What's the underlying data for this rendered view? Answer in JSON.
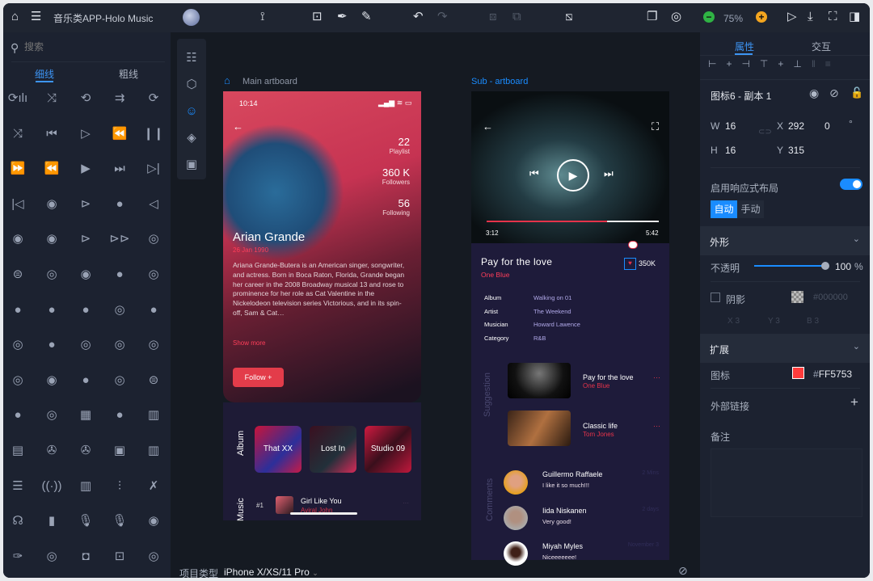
{
  "app": {
    "title": "音乐类APP-Holo Music",
    "zoom": "75%"
  },
  "toolbar": {
    "icons": [
      "home-icon",
      "menu-icon",
      "avatar",
      "path-icon",
      "add-frame-icon",
      "pen-icon",
      "pencil-icon",
      "undo-icon",
      "redo-icon",
      "group-icon",
      "ungroup-icon",
      "resize-icon",
      "preview-frame-icon",
      "settings-icon",
      "zoom-out-icon",
      "zoom-in-icon",
      "play-icon",
      "download-icon",
      "fullscreen-icon",
      "panel-toggle-icon"
    ]
  },
  "left": {
    "search_placeholder": "搜索",
    "tabs": [
      "细线",
      "粗线"
    ],
    "active_tab": 0,
    "icons": [
      "repeat-one",
      "equalizer",
      "shuffle",
      "repeat",
      "list-arrows",
      "repeat-list",
      "shuffle-2",
      "skip-back-filled",
      "play-outline",
      "rewind-outline",
      "pause",
      "fast-forward-filled",
      "rewind-filled",
      "play-filled",
      "skip-next-filled",
      "skip-next-outline",
      "skip-back-outline",
      "prev-circle-filled",
      "next-circle-outline",
      "play-circle-filled",
      "rewind-circle",
      "next-circle-filled",
      "prev-circle-2",
      "play-circle-outline",
      "fast-forward-outline",
      "skip-back-circle",
      "eject-down-circle",
      "skip-next-circle",
      "next-circle-2",
      "eject-down-filled",
      "audio-circle",
      "audio-circle-filled",
      "pause-circle-filled",
      "eject-circle-filled",
      "eject-circle-outline",
      "stop-circle-filled",
      "stop-circle",
      "eject-circle-2",
      "stop-circle-2",
      "record-circle",
      "eject-circle-3",
      "pause-circle",
      "volume-circle",
      "volume-circle-filled",
      "play-circle-3",
      "down-circle",
      "down-circle-filled",
      "prev-circle-3",
      "film-filled",
      "prev-circle-4",
      "film",
      "clapper",
      "reel-filled",
      "reel",
      "video-frame",
      "mixer-filled",
      "sliders",
      "broadcast",
      "mixer",
      "sliders-vertical",
      "mic-off",
      "headset",
      "mic-stand",
      "microphone",
      "microphone-outline",
      "mic-circle",
      "karaoke-mic",
      "play-circle-4",
      "webcam",
      "presentation"
    ],
    "project_type_label": "项目类型",
    "project_type": "iPhone X/XS/11 Pro"
  },
  "rail": {
    "icons": [
      "layers-tree-icon",
      "cube-icon",
      "emoji-icon",
      "stack-icon",
      "component-icon"
    ],
    "active": 2
  },
  "main_artboard": {
    "label": "Main artboard",
    "time": "10:14",
    "stats": [
      {
        "value": "22",
        "label": "Playlist"
      },
      {
        "value": "360 K",
        "label": "Followers"
      },
      {
        "value": "56",
        "label": "Following"
      }
    ],
    "name": "Arian Grande",
    "date": "26 Jan 1990",
    "bio": "Ariana Grande-Butera is an American singer, songwriter, and actress. Born in Boca Raton, Florida, Grande began her career in the 2008 Broadway musical 13 and rose to prominence for her role as Cat Valentine in the Nickelodeon television series Victorious, and in its spin-off, Sam & Cat…",
    "show_more": "Show more",
    "follow": "Follow +",
    "album_label": "Album",
    "albums": [
      "That XX",
      "Lost In",
      "Studio 09"
    ],
    "music_label": "Music",
    "track": {
      "rank": "#1",
      "title": "Girl Like You",
      "artist": "Aviral John"
    }
  },
  "sub_artboard": {
    "label": "Sub - artboard",
    "elapsed": "3:12",
    "total": "5:42",
    "progress": 0.7,
    "song": "Pay for the love",
    "artist": "One Blue",
    "likes": "350K",
    "details": [
      {
        "k": "Album",
        "v": "Walking on 01"
      },
      {
        "k": "Artist",
        "v": "The Weekend"
      },
      {
        "k": "Musician",
        "v": "Howard Lawence"
      },
      {
        "k": "Category",
        "v": "R&B"
      }
    ],
    "suggestion_label": "Suggestion",
    "suggestions": [
      {
        "title": "Pay for the love",
        "artist": "One Blue"
      },
      {
        "title": "Classic life",
        "artist": "Tom Jones"
      }
    ],
    "comments_label": "Comments",
    "comments": [
      {
        "name": "Guillermo Raffaele",
        "text": "I like it so much!!!",
        "time": "2 Mins"
      },
      {
        "name": "Iida Niskanen",
        "text": "Very good!",
        "time": "2 days"
      },
      {
        "name": "Miyah Myles",
        "text": "Niceeeeeee!",
        "time": "November 3"
      }
    ]
  },
  "right": {
    "tabs": [
      "属性",
      "交互"
    ],
    "active_tab": 0,
    "layer_name": "图标6 - 副本 1",
    "w_label": "W",
    "w": "16",
    "h_label": "H",
    "h": "16",
    "x_label": "X",
    "x": "292",
    "y_label": "Y",
    "y": "315",
    "rotation": "0",
    "degree": "°",
    "responsive_label": "启用响应式布局",
    "responsive_on": true,
    "modes": [
      "自动",
      "手动"
    ],
    "appearance": "外形",
    "opacity_label": "不透明",
    "opacity": "100",
    "percent": "%",
    "opacity_value": 1.0,
    "shadow_label": "阴影",
    "shadow_color": "#000000",
    "shadow_xyb": [
      "X 3",
      "Y 3",
      "B 3"
    ],
    "extend": "扩展",
    "icon_label": "图标",
    "icon_color_hash": "#",
    "icon_color": "FF5753",
    "link_label": "外部链接",
    "notes_label": "备注"
  },
  "colors": {
    "accent": "#1a8cff",
    "red": "#ff5753",
    "icon_swatch": "#FF5753"
  }
}
